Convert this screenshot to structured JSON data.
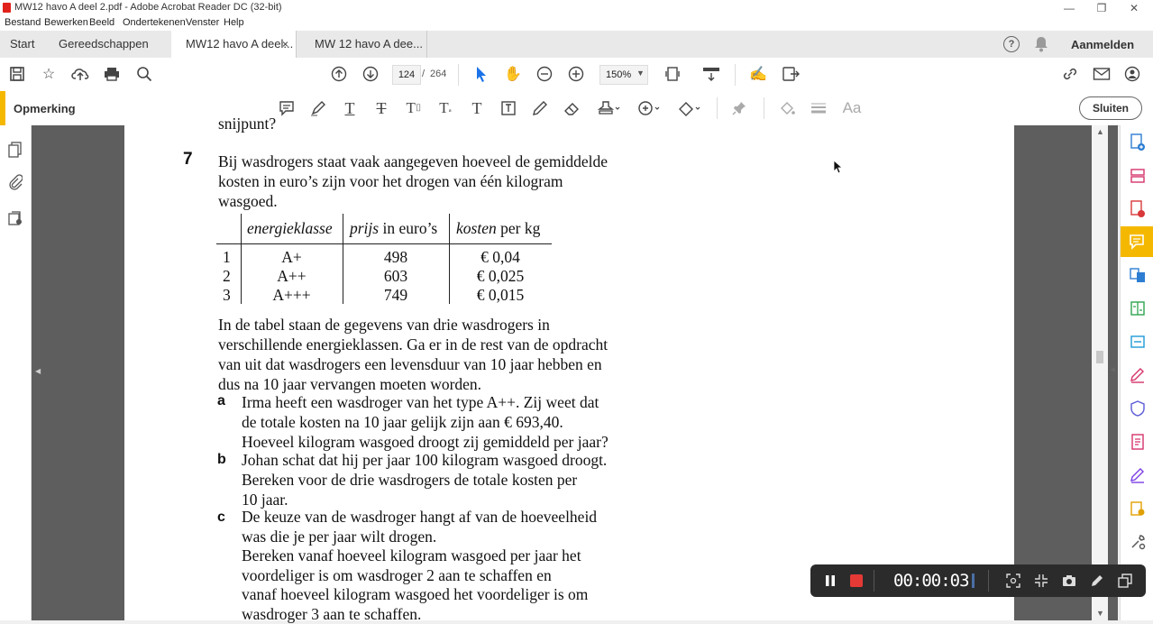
{
  "window": {
    "title": "MW12 havo A deel 2.pdf - Adobe Acrobat Reader DC (32-bit)"
  },
  "menu": [
    "Bestand",
    "Bewerken",
    "Beeld",
    "Ondertekenen",
    "Venster",
    "Help"
  ],
  "tabs": {
    "start": "Start",
    "tools": "Gereedschappen",
    "doc1": "MW12 havo A deel...",
    "doc2": "MW 12 havo A dee...",
    "close": "×",
    "signin": "Aanmelden",
    "help": "?"
  },
  "toolbar": {
    "page_current": "124",
    "page_sep": "/",
    "page_total": "264",
    "zoom": "150%"
  },
  "commentbar": {
    "label": "Opmerking",
    "close_label": "Sluiten"
  },
  "document": {
    "partial_top": "snijpunt?",
    "question_number": "7",
    "intro": [
      "Bij wasdrogers staat vaak aangegeven hoeveel de gemiddelde",
      "kosten in euro’s zijn voor het drogen van één kilogram",
      "wasgoed."
    ],
    "table": {
      "headers": [
        {
          "em": "energieklasse",
          "rest": ""
        },
        {
          "em": "prijs",
          "rest": " in euro’s"
        },
        {
          "em": "kosten",
          "rest": " per kg"
        }
      ],
      "rows": [
        [
          "1",
          "A+",
          "498",
          "€ 0,04"
        ],
        [
          "2",
          "A++",
          "603",
          "€ 0,025"
        ],
        [
          "3",
          "A+++",
          "749",
          "€ 0,015"
        ]
      ]
    },
    "para": [
      "In de tabel staan de gegevens van drie wasdrogers in",
      "verschillende energieklassen. Ga er in de rest van de opdracht",
      "van uit dat wasdrogers een levensduur van 10 jaar hebben en",
      "dus na 10 jaar vervangen moeten worden."
    ],
    "items": [
      {
        "label": "a",
        "lines": [
          "Irma heeft een wasdroger van het type A++. Zij weet dat",
          "de totale kosten na 10 jaar gelijk zijn aan € 693,40.",
          "Hoeveel kilogram wasgoed droogt zij gemiddeld per jaar?"
        ]
      },
      {
        "label": "b",
        "lines": [
          "Johan schat dat hij per jaar 100 kilogram wasgoed droogt.",
          "Bereken voor de drie wasdrogers de totale kosten per",
          "10 jaar."
        ]
      },
      {
        "label": "c",
        "lines": [
          "De keuze van de wasdroger hangt af van de hoeveelheid",
          "was die je per jaar wilt drogen.",
          "Bereken vanaf hoeveel kilogram wasgoed per jaar het",
          "voordeliger is om wasdroger 2 aan te schaffen en",
          "vanaf hoeveel kilogram wasgoed het voordeliger is om",
          "wasdroger 3 aan te schaffen."
        ]
      }
    ]
  },
  "recorder": {
    "time": "00:00:03"
  }
}
